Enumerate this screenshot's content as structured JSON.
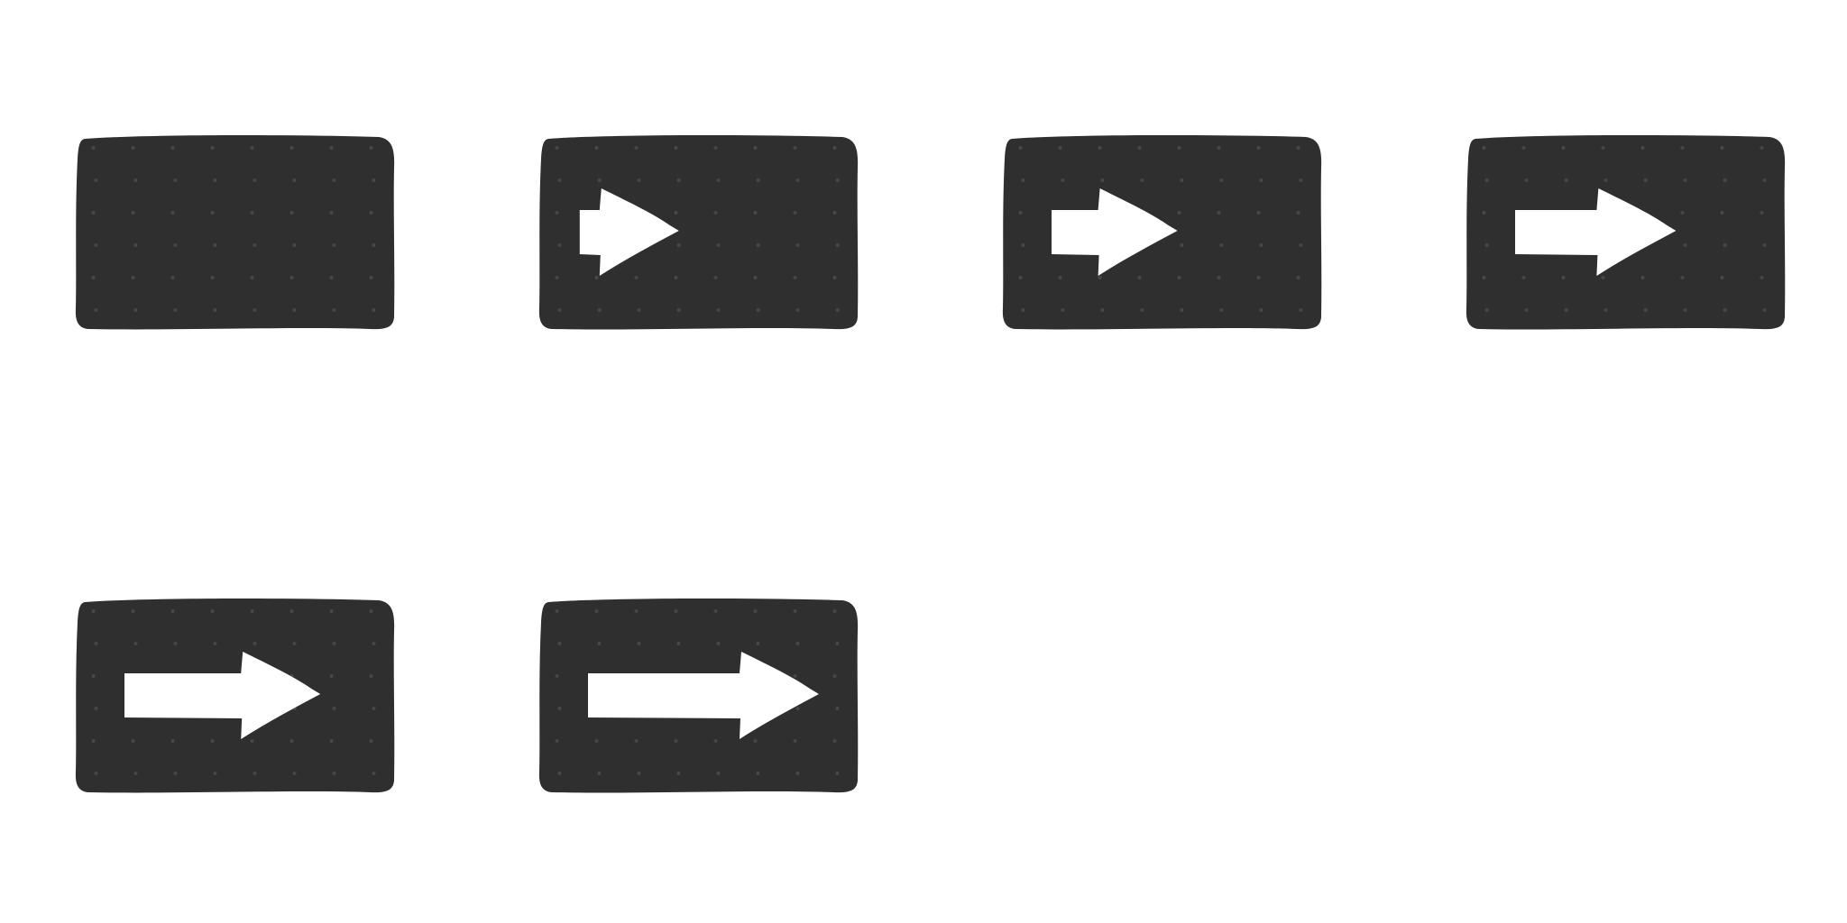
{
  "colors": {
    "background": "#ffffff",
    "panel": "#2f2f2f",
    "panel_texture": "#474747",
    "arrow": "#ffffff"
  },
  "frames": [
    {
      "arrow_progress": 0.0,
      "icon": "none"
    },
    {
      "arrow_progress": 0.2,
      "icon": "right-arrow-icon"
    },
    {
      "arrow_progress": 0.4,
      "icon": "right-arrow-icon"
    },
    {
      "arrow_progress": 0.6,
      "icon": "right-arrow-icon"
    },
    {
      "arrow_progress": 0.8,
      "icon": "right-arrow-icon"
    },
    {
      "arrow_progress": 1.0,
      "icon": "right-arrow-icon"
    }
  ]
}
